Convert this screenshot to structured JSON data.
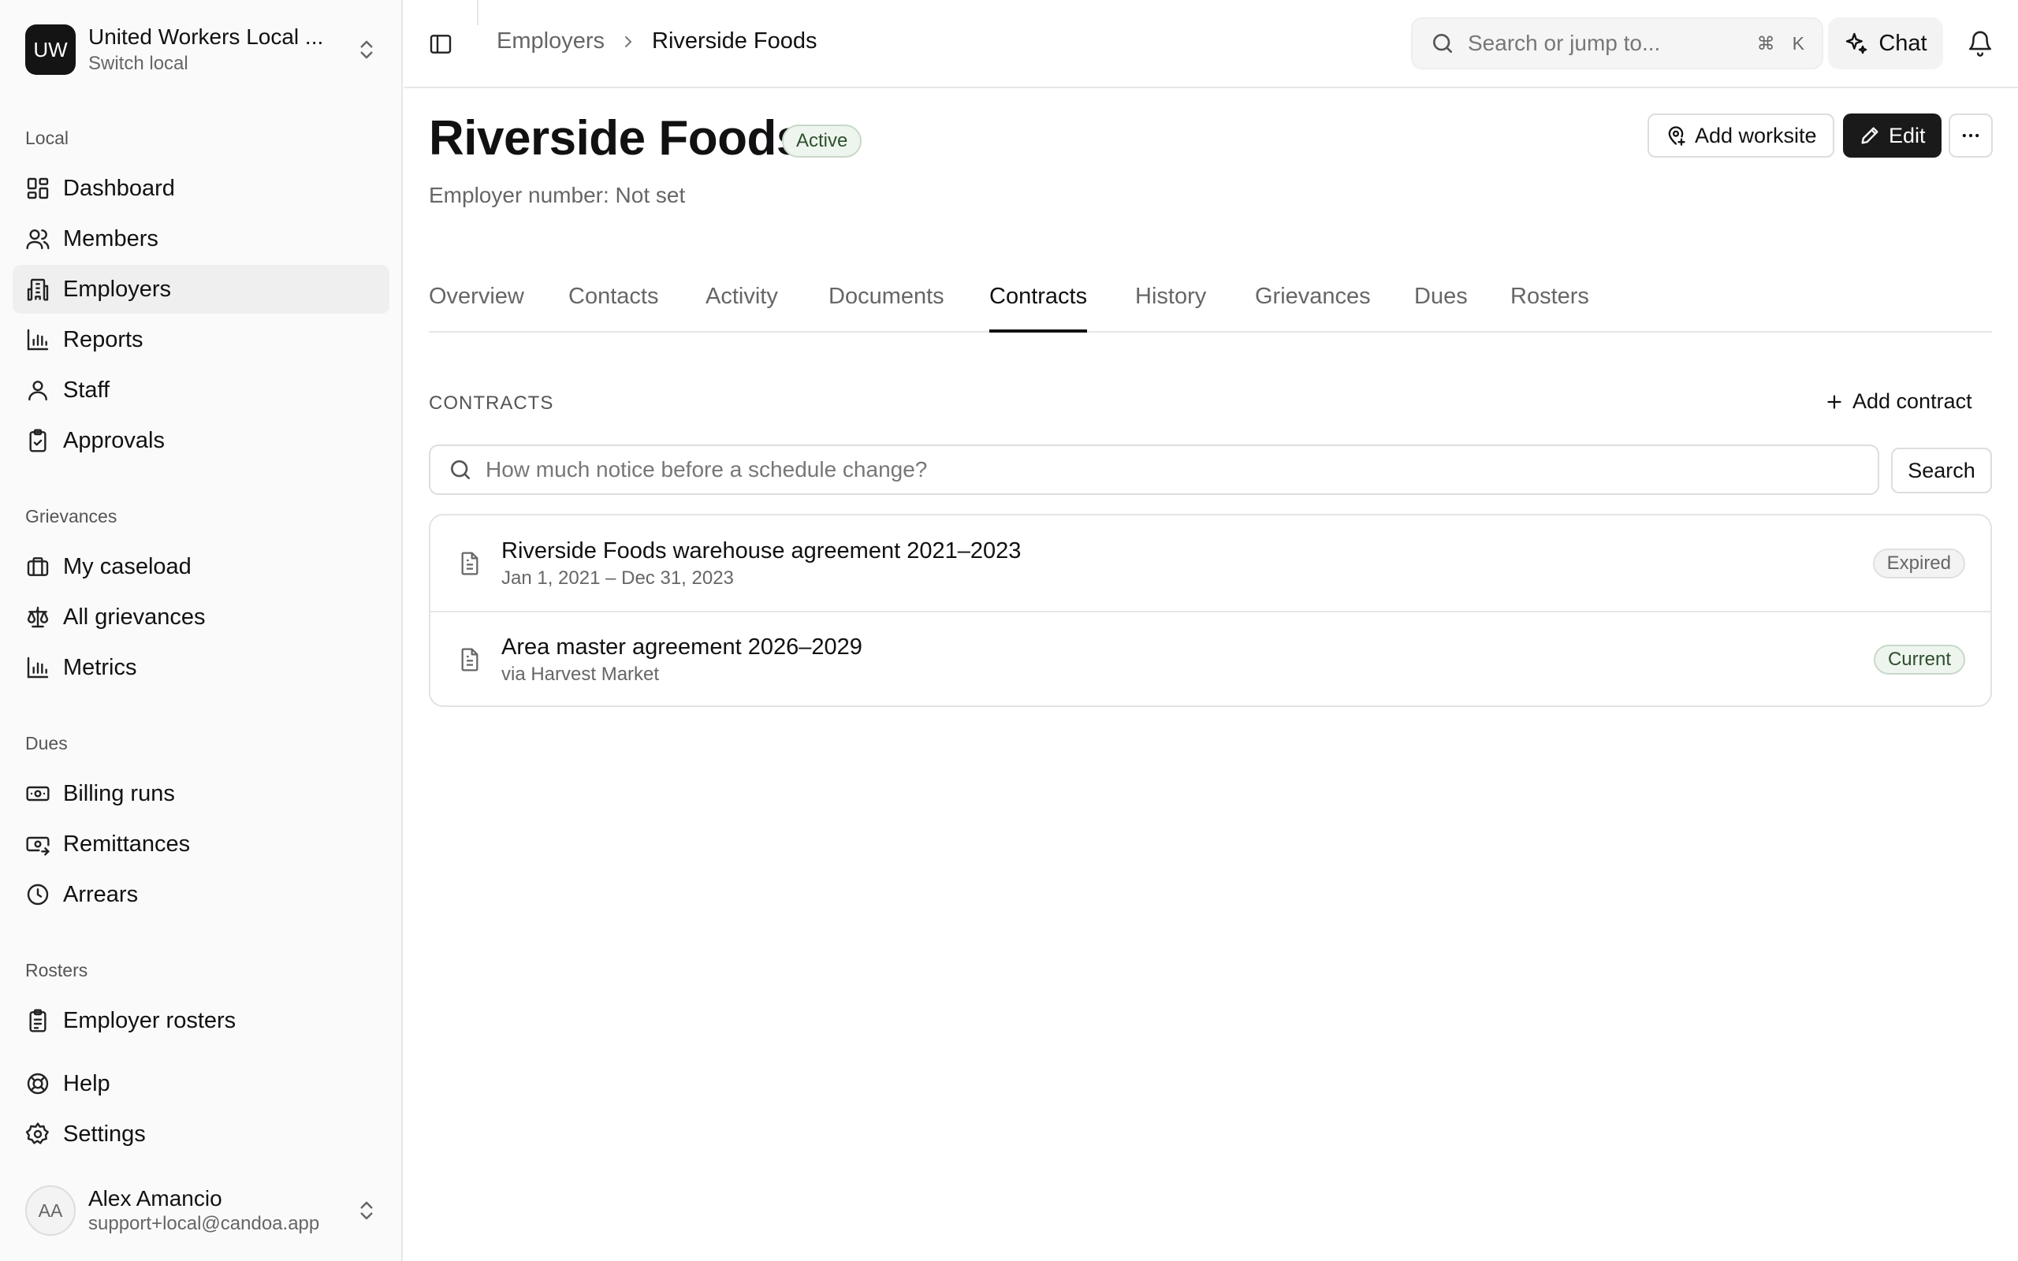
{
  "org": {
    "initials": "UW",
    "name": "United Workers Local ...",
    "switch_label": "Switch local"
  },
  "sidebar": {
    "sections": [
      {
        "label": "Local",
        "items": [
          {
            "label": "Dashboard",
            "icon": "dashboard-icon"
          },
          {
            "label": "Members",
            "icon": "users-icon"
          },
          {
            "label": "Employers",
            "icon": "building-icon",
            "active": true
          },
          {
            "label": "Reports",
            "icon": "bar-chart-icon"
          },
          {
            "label": "Staff",
            "icon": "user-icon"
          },
          {
            "label": "Approvals",
            "icon": "clipboard-check-icon"
          }
        ]
      },
      {
        "label": "Grievances",
        "items": [
          {
            "label": "My caseload",
            "icon": "briefcase-icon"
          },
          {
            "label": "All grievances",
            "icon": "scale-icon"
          },
          {
            "label": "Metrics",
            "icon": "bar-chart-icon"
          }
        ]
      },
      {
        "label": "Dues",
        "items": [
          {
            "label": "Billing runs",
            "icon": "banknote-icon"
          },
          {
            "label": "Remittances",
            "icon": "remittance-icon"
          },
          {
            "label": "Arrears",
            "icon": "clock-icon"
          }
        ]
      },
      {
        "label": "Rosters",
        "items": [
          {
            "label": "Employer rosters",
            "icon": "clipboard-list-icon"
          }
        ]
      }
    ],
    "footer_items": [
      {
        "label": "Help",
        "icon": "lifebuoy-icon"
      },
      {
        "label": "Settings",
        "icon": "gear-icon"
      }
    ]
  },
  "user": {
    "initials": "AA",
    "name": "Alex Amancio",
    "email": "support+local@candoa.app"
  },
  "topbar": {
    "breadcrumb": [
      "Employers",
      "Riverside Foods"
    ],
    "search_placeholder": "Search or jump to...",
    "shortcut_cmd": "⌘",
    "shortcut_key": "K",
    "chat_label": "Chat"
  },
  "header": {
    "title": "Riverside Foods",
    "status": "Active",
    "employer_number": "Employer number: Not set",
    "add_worksite_label": "Add worksite",
    "edit_label": "Edit"
  },
  "tabs": [
    {
      "label": "Overview"
    },
    {
      "label": "Contacts"
    },
    {
      "label": "Activity"
    },
    {
      "label": "Documents"
    },
    {
      "label": "Contracts",
      "active": true
    },
    {
      "label": "History"
    },
    {
      "label": "Grievances"
    },
    {
      "label": "Dues"
    },
    {
      "label": "Rosters"
    }
  ],
  "contracts": {
    "section_title": "CONTRACTS",
    "add_label": "Add contract",
    "search_placeholder": "How much notice before a schedule change?",
    "search_button": "Search",
    "items": [
      {
        "title": "Riverside Foods warehouse agreement 2021–2023",
        "subtitle": "Jan 1, 2021 – Dec 31, 2023",
        "status": "Expired"
      },
      {
        "title": "Area master agreement 2026–2029",
        "subtitle": "via Harvest Market",
        "status": "Current"
      }
    ]
  },
  "colors": {
    "accent_dark": "#1a1a1a",
    "active_badge_bg": "#eef4ee",
    "expired_badge_bg": "#f3f3f3"
  }
}
